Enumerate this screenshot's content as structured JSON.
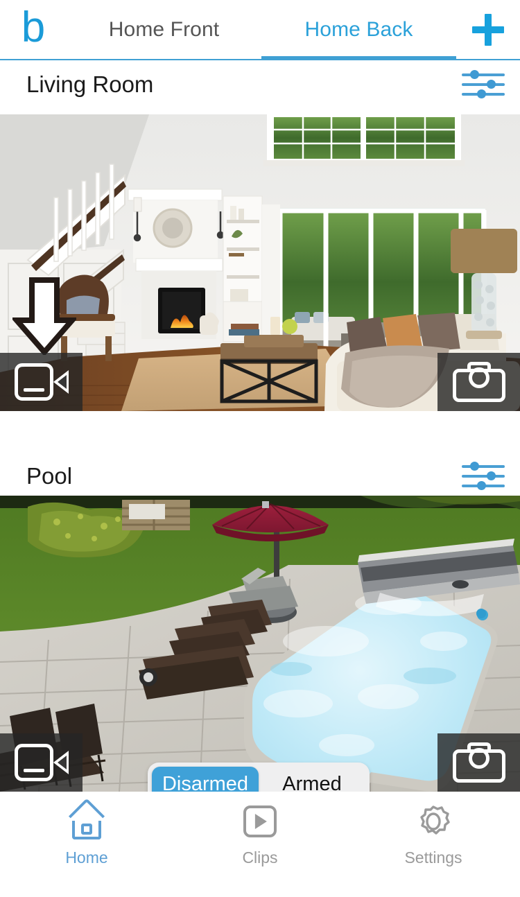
{
  "app": {
    "brand_logo": "blink-b-logo",
    "accent_color": "#3fa0d4",
    "inactive_color": "#9a9a9a"
  },
  "header": {
    "logo_text": "b",
    "tabs": [
      {
        "label": "Home Front",
        "active": false
      },
      {
        "label": "Home Back",
        "active": true
      }
    ],
    "add_button": {
      "icon": "plus-icon",
      "label": "+"
    }
  },
  "cameras": [
    {
      "name": "Living Room",
      "settings_icon": "sliders-icon",
      "record_button": {
        "icon": "video-camera-icon",
        "label": "Record video"
      },
      "snapshot_button": {
        "icon": "photo-camera-icon",
        "label": "Take photo"
      },
      "annotation": {
        "icon": "down-arrow-annotation",
        "points_at": "record-video-button"
      },
      "scene": "indoor-living-room-fireplace-staircase"
    },
    {
      "name": "Pool",
      "settings_icon": "sliders-icon",
      "record_button": {
        "icon": "video-camera-icon",
        "label": "Record video"
      },
      "snapshot_button": {
        "icon": "photo-camera-icon",
        "label": "Take photo"
      },
      "scene": "outdoor-backyard-swimming-pool"
    }
  ],
  "arm_control": {
    "options": [
      {
        "label": "Disarmed",
        "selected": true
      },
      {
        "label": "Armed",
        "selected": false
      }
    ]
  },
  "tabbar": {
    "items": [
      {
        "label": "Home",
        "icon": "home-icon",
        "active": true
      },
      {
        "label": "Clips",
        "icon": "play-clip-icon",
        "active": false
      },
      {
        "label": "Settings",
        "icon": "gear-icon",
        "active": false
      }
    ]
  }
}
